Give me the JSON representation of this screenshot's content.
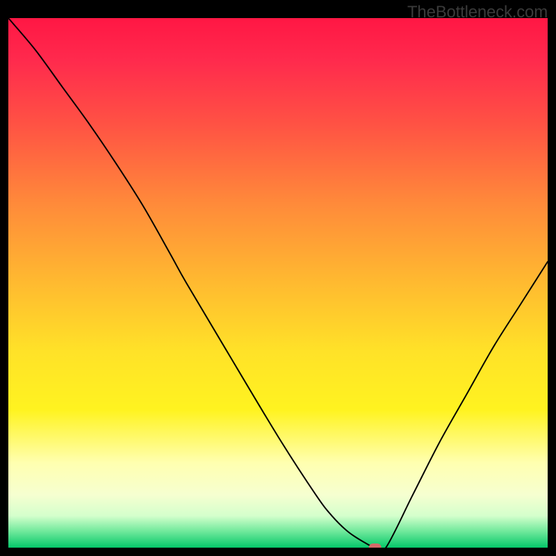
{
  "watermark": "TheBottleneck.com",
  "chart_data": {
    "type": "line",
    "title": "",
    "xlabel": "",
    "ylabel": "",
    "ylim": [
      0,
      100
    ],
    "x": [
      0,
      5,
      10,
      15,
      20,
      25,
      30,
      33,
      40,
      50,
      57,
      60,
      63,
      66,
      68,
      70,
      75,
      80,
      85,
      90,
      95,
      100
    ],
    "values": [
      100,
      94,
      87,
      80,
      72.5,
      64.5,
      55.5,
      50,
      38,
      21,
      10,
      6,
      3,
      1,
      0,
      0,
      10,
      20,
      29,
      38,
      46,
      54
    ],
    "marker": {
      "x": 68,
      "y": 0,
      "color": "#d46a6a"
    }
  }
}
